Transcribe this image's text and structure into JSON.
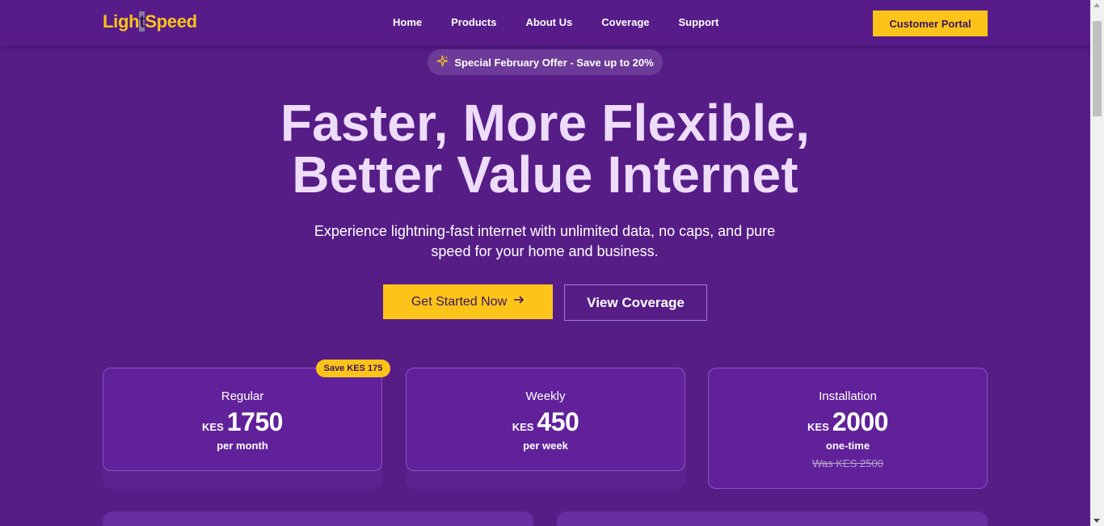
{
  "header": {
    "logo_part1": "Ligh",
    "logo_caret": "t",
    "logo_part2": "Speed",
    "nav": [
      "Home",
      "Products",
      "About Us",
      "Coverage",
      "Support"
    ],
    "portal_label": "Customer Portal"
  },
  "offer": {
    "icon": "sparkle-icon",
    "text": "Special February Offer - Save up to 20%"
  },
  "hero": {
    "title_line1": "Faster, More Flexible,",
    "title_line2": "Better Value Internet",
    "subtitle": "Experience lightning-fast internet with unlimited data, no caps, and pure speed for your home and business.",
    "primary_label": "Get Started Now",
    "primary_icon": "arrow-right-icon",
    "secondary_label": "View Coverage"
  },
  "plans": [
    {
      "title": "Regular",
      "currency": "KES",
      "amount": "1750",
      "period": "per month",
      "badge": "Save KES 175"
    },
    {
      "title": "Weekly",
      "currency": "KES",
      "amount": "450",
      "period": "per week"
    },
    {
      "title": "Installation",
      "currency": "KES",
      "amount": "2000",
      "period": "one-time",
      "was": "Was KES 2500"
    }
  ],
  "colors": {
    "background": "#561d87",
    "accent": "#fcc419",
    "title": "#eedcfb"
  }
}
